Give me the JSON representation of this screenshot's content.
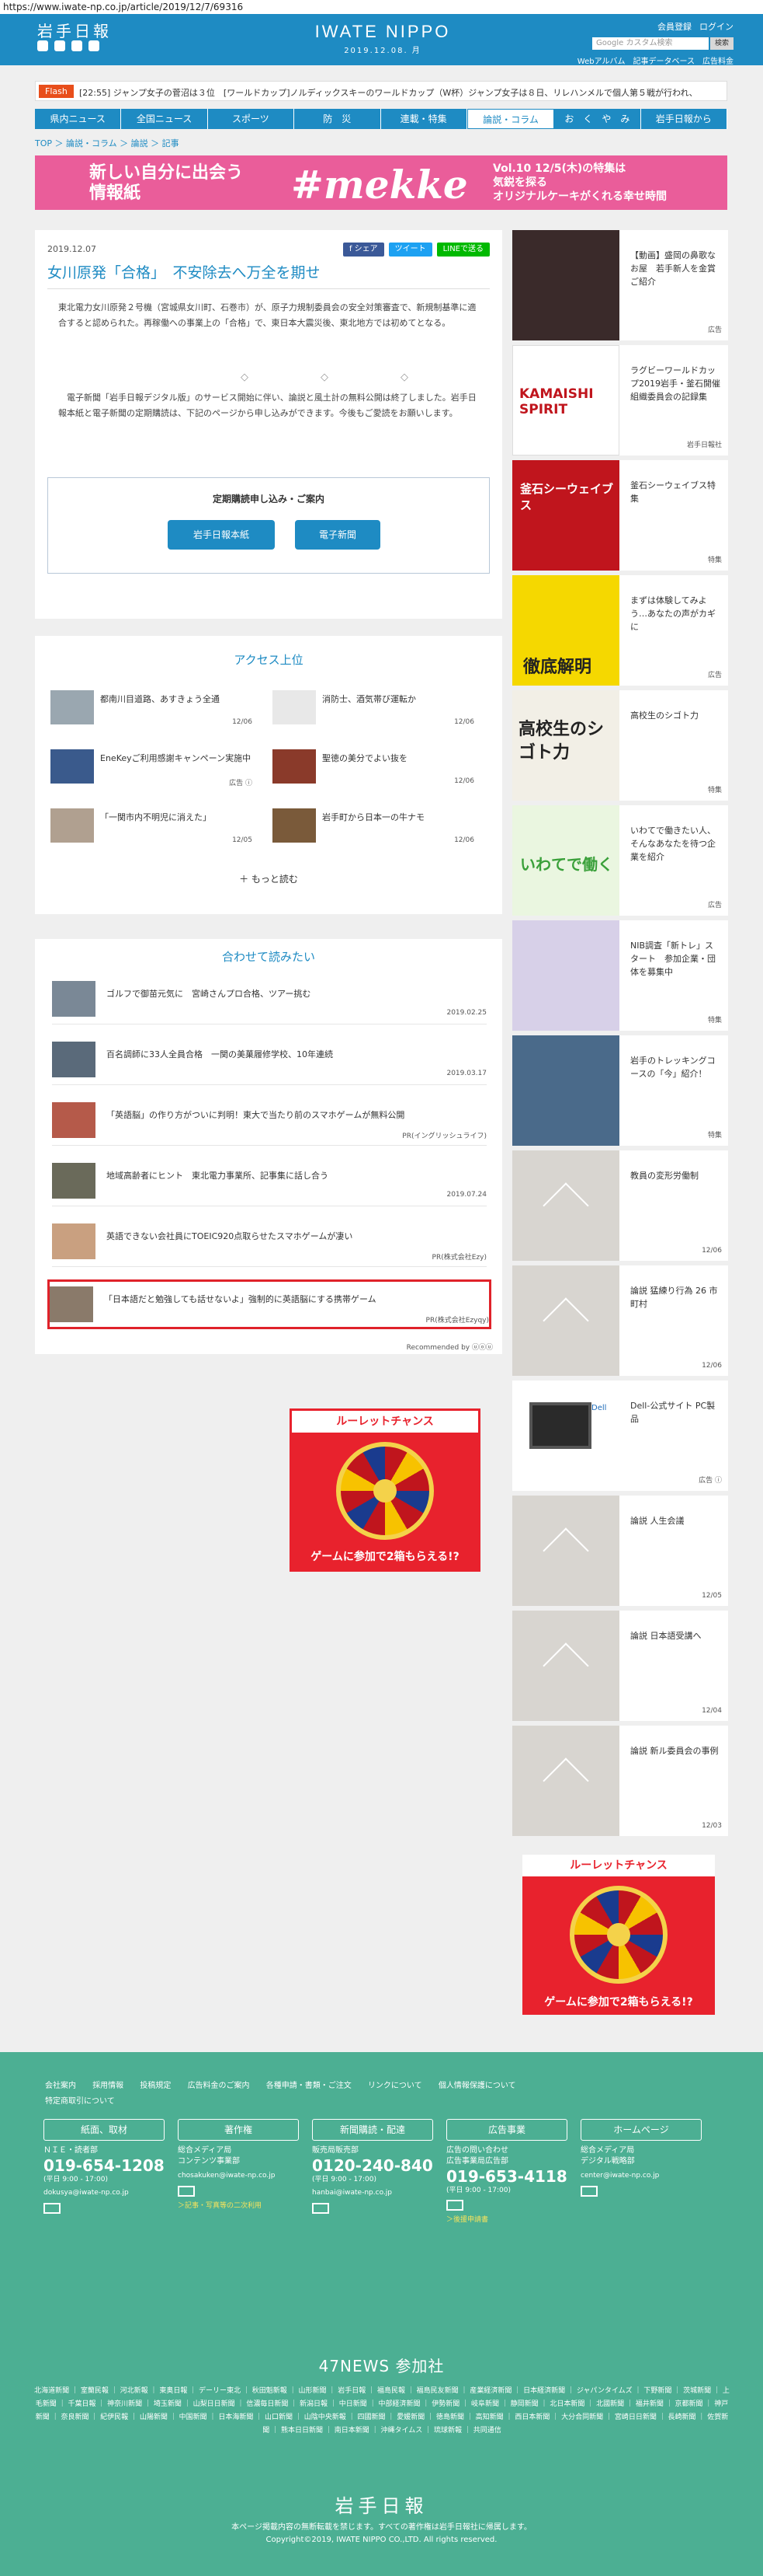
{
  "url": "https://www.iwate-np.co.jp/article/2019/12/7/69316",
  "header": {
    "logo": "岩手日報",
    "site_name": "IWATE NIPPO",
    "date": "2019.12.08. 月",
    "links": [
      "会員登録",
      "ログイン"
    ],
    "search_placeholder": "Google カスタム検索",
    "search_button": "検索",
    "sub_links": [
      "Webアルバム",
      "記事データベース",
      "広告料金"
    ]
  },
  "breaking": {
    "label": "Flash",
    "text": "[22:55] ジャンプ女子の菅沼は３位　[ワールドカップ]ノルディックスキーのワールドカップ（W杯）ジャンプ女子は８日、リレハンメルで個人第５戦が行われ、"
  },
  "nav": {
    "items": [
      "県内ニュース",
      "全国ニュース",
      "スポーツ",
      "防　災",
      "連載・特集",
      "論説・コラム",
      "お　く　や　み",
      "岩手日報から"
    ],
    "active": 5
  },
  "breadcrumb": "TOP ＞ 論説・コラム ＞ 論説 ＞ 記事",
  "banner": {
    "left": "新しい自分に出会う\n情報紙",
    "brand": "#mekke",
    "right": "Vol.10 12/5(木)の特集は\n気鋭を探る\nオリジナルケーキがくれる幸せ時間"
  },
  "article": {
    "date": "2019.12.07",
    "share": [
      "f シェア",
      "ツイート",
      "LINEで送る"
    ],
    "title": "女川原発「合格」　不安除去へ万全を期せ",
    "body1": "東北電力女川原発２号機（宮城県女川町、石巻市）が、原子力規制委員会の安全対策審査で、新規制基準に適合すると認められた。再稼働への事業上の「合格」で、東日本大震災後、東北地方では初めてとなる。",
    "separator": "◇　◇　◇",
    "body2": "　電子新聞「岩手日報デジタル版」のサービス開始に伴い、論説と風土計の無料公開は終了しました。岩手日報本紙と電子新聞の定期購読は、下記のページから申し込みができます。今後もご愛読をお願いします。",
    "subscribe_title": "定期購読申し込み・ご案内",
    "btn_paper": "岩手日報本紙",
    "btn_digital": "電子新聞"
  },
  "access": {
    "title": "アクセス上位",
    "items": [
      {
        "title": "都南川目道路、あすきょう全通",
        "date": "12/06"
      },
      {
        "title": "消防士、酒気帯び運転か",
        "date": "12/06"
      },
      {
        "title": "EneKeyご利用感謝キャンペーン実施中",
        "date": "広告 ⓘ"
      },
      {
        "title": "聖徳の美分でよい抜を",
        "date": "12/06"
      },
      {
        "title": "「一関市内不明児に消えた」",
        "date": "12/05"
      },
      {
        "title": "岩手町から日本一の牛ナモ",
        "date": "12/06"
      }
    ],
    "more": "＋ もっと読む"
  },
  "related": {
    "title": "合わせて読みたい",
    "items": [
      {
        "title": "ゴルフで御苗元気に　宮崎さんプロ合格、ツアー挑む",
        "date": "2019.02.25"
      },
      {
        "title": "百名調師に33人全員合格　一関の美菓履修学校、10年連続",
        "date": "2019.03.17"
      },
      {
        "title": "「英語脳」の作り方がついに判明！東大で当たり前のスマホゲームが無料公開",
        "date": "PR(イングリッシュライフ)"
      },
      {
        "title": "地域高齢者にヒント　東北電力事業所、記事集に話し合う",
        "date": "2019.07.24"
      },
      {
        "title": "英語できない会社員にTOEIC920点取らせたスマホゲームが凄い",
        "date": "PR(株式会社Ezy)"
      },
      {
        "title": "「日本語だと勉強しても話せないよ」強制的に英語脳にする携帯ゲーム",
        "date": "PR(株式会社Ezyqy)"
      }
    ],
    "recommend": "Recommended by ⓤⓞⓤ"
  },
  "ad": {
    "top": "ルーレットチャンス",
    "bottom": "ゲームに参加で2箱もらえる!?"
  },
  "sidebar": [
    {
      "title": "【動画】盛岡の鼻歌なお屋　若手新人を金賞ご紹介",
      "date": "広告"
    },
    {
      "title": "ラグビーワールドカップ2019岩手・釜石開催組織委員会の記録集",
      "date": "岩手日報社"
    },
    {
      "title": "釜石シーウェイブス特集",
      "date": "特集"
    },
    {
      "title": "まずは体験してみよう…あなたの声がカギに",
      "date": "広告"
    },
    {
      "title": "高校生のシゴト力",
      "date": "特集"
    },
    {
      "title": "いわてで働きたい人、そんなあなたを待つ企業を紹介",
      "date": "広告"
    },
    {
      "title": "NIB調査「新トレ」スタート　参加企業・団体を募集中",
      "date": "特集"
    },
    {
      "title": "岩手のトレッキングコースの「今」紹介！",
      "date": "特集"
    },
    {
      "title": "教員の変形労働制",
      "date": "12/06"
    },
    {
      "title": "論説 猛練り行為 26 市町村",
      "date": "12/06"
    },
    {
      "title": "Dell-公式サイト PC製品",
      "date": "広告 ⓘ"
    },
    {
      "title": "論説 人生会議",
      "date": "12/05"
    },
    {
      "title": "論説 日本語受講へ",
      "date": "12/04"
    },
    {
      "title": "論説 新ル委員会の事例",
      "date": "12/03"
    }
  ],
  "sidebar_art": {
    "kamaishi": "KAMAISHI SPIRIT",
    "seawaves": "釜石シーウェイブス",
    "tettei": "徹底解明",
    "shigoto": "高校生のシゴト力",
    "iwate": "いわてで働く",
    "dell": "Dell"
  },
  "footer": {
    "links": [
      "会社案内",
      "採用情報",
      "投稿規定",
      "広告料金のご案内",
      "各種申請・書類・ご注文",
      "リンクについて",
      "個人情報保護について",
      "特定商取引について"
    ],
    "cols": [
      {
        "cap": "紙面、取材",
        "l1": "ＮＩＥ・読者部",
        "phone": "019-654-1208",
        "hours": "(平日 9:00 - 17:00)",
        "mail": "dokusya@iwate-np.co.jp"
      },
      {
        "cap": "著作権",
        "l1": "総合メディア局\nコンテンツ事業部",
        "phone": "",
        "hours": "",
        "mail": "chosakuken@iwate-np.co.jp",
        "extra": "＞記事・写真等の二次利用"
      },
      {
        "cap": "新聞購読・配達",
        "l1": "販売局販売部",
        "phone": "0120-240-840",
        "hours": "(平日 9:00 - 17:00)",
        "mail": "hanbai@iwate-np.co.jp"
      },
      {
        "cap": "広告事業",
        "l1": "広告の問い合わせ\n広告事業局広告部",
        "phone": "019-653-4118",
        "hours": "(平日 9:00 - 17:00)",
        "mail": "",
        "extra": "＞後援申請書"
      },
      {
        "cap": "ホームページ",
        "l1": "総合メディア局\nデジタル戦略部",
        "phone": "",
        "hours": "",
        "mail": "center@iwate-np.co.jp"
      }
    ],
    "n47_title": "47NEWS 参加社",
    "n47_list": "北海道新聞 ｜ 室蘭民報 ｜ 河北新報 ｜ 東奥日報 ｜ デーリー東北 ｜ 秋田魁新報 ｜ 山形新聞 ｜ 岩手日報 ｜ 福島民報 ｜ 福島民友新聞 ｜ 産業経済新聞 ｜ 日本経済新聞 ｜ ジャパンタイムズ ｜ 下野新聞 ｜ 茨城新聞 ｜ 上毛新聞 ｜ 千葉日報 ｜ 神奈川新聞 ｜ 埼玉新聞 ｜ 山梨日日新聞 ｜ 信濃毎日新聞 ｜ 新潟日報 ｜ 中日新聞 ｜ 中部経済新聞 ｜ 伊勢新聞 ｜ 岐阜新聞 ｜ 静岡新聞 ｜ 北日本新聞 ｜ 北國新聞 ｜ 福井新聞 ｜ 京都新聞 ｜ 神戸新聞 ｜ 奈良新聞 ｜ 紀伊民報 ｜ 山陽新聞 ｜ 中国新聞 ｜ 日本海新聞 ｜ 山口新聞 ｜ 山陰中央新報 ｜ 四國新聞 ｜ 愛媛新聞 ｜ 徳島新聞 ｜ 高知新聞 ｜ 西日本新聞 ｜ 大分合同新聞 ｜ 宮崎日日新聞 ｜ 長崎新聞 ｜ 佐賀新聞 ｜ 熊本日日新聞 ｜ 南日本新聞 ｜ 沖縄タイムス ｜ 琉球新報 ｜ 共同通信",
    "logo": "岩手日報",
    "copy1": "本ページ掲載内容の無断転載を禁じます。すべての著作権は岩手日報社に帰属します。",
    "copy2": "Copyright©2019, IWATE NIPPO CO.,LTD. All rights reserved."
  }
}
